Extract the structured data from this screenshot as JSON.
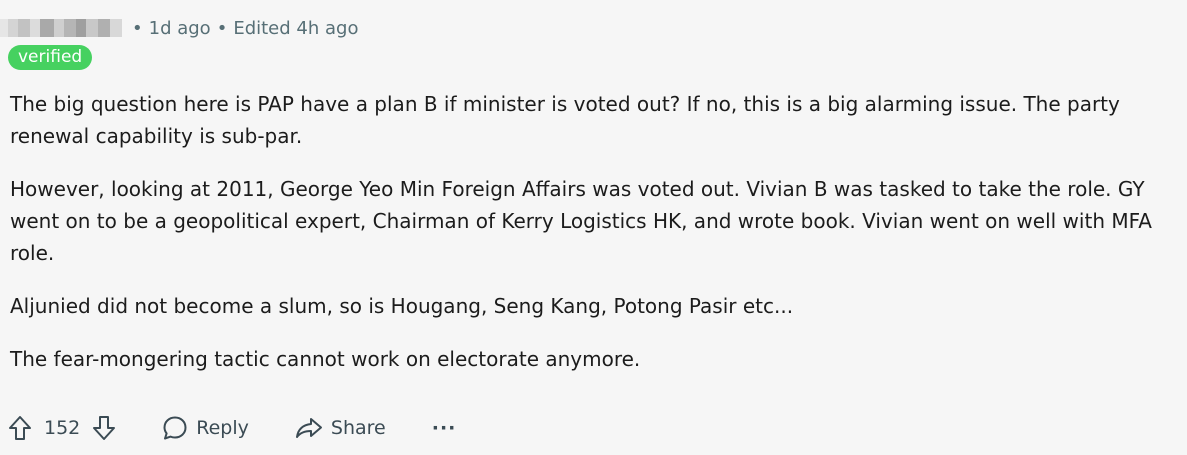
{
  "comment": {
    "author_blurred": true,
    "time_ago": "1d ago",
    "edited": "Edited 4h ago",
    "flair": "verified",
    "paragraphs": [
      "The big question here is PAP have a plan B if minister is voted out? If no, this is a big alarming issue. The party renewal capability is sub-par.",
      "However, looking at 2011, George Yeo Min Foreign Affairs was voted out. Vivian B was tasked to take the role. GY went on to be a geopolitical expert, Chairman of Kerry Logistics HK, and wrote book. Vivian went on well with MFA role.",
      "Aljunied did not become a slum, so is Hougang, Seng Kang, Potong Pasir etc...",
      "The fear-mongering tactic cannot work on electorate anymore."
    ]
  },
  "actions": {
    "score": "152",
    "reply_label": "Reply",
    "share_label": "Share",
    "more_label": "···"
  },
  "icons": {
    "upvote": "arrow-up-icon",
    "downvote": "arrow-down-icon",
    "reply": "speech-bubble-icon",
    "share": "share-arrow-icon",
    "more": "ellipsis-icon"
  },
  "colors": {
    "background": "#f6f6f6",
    "flair_bg": "#46d160",
    "meta_text": "#576f76",
    "body_text": "#1c1c1c"
  }
}
